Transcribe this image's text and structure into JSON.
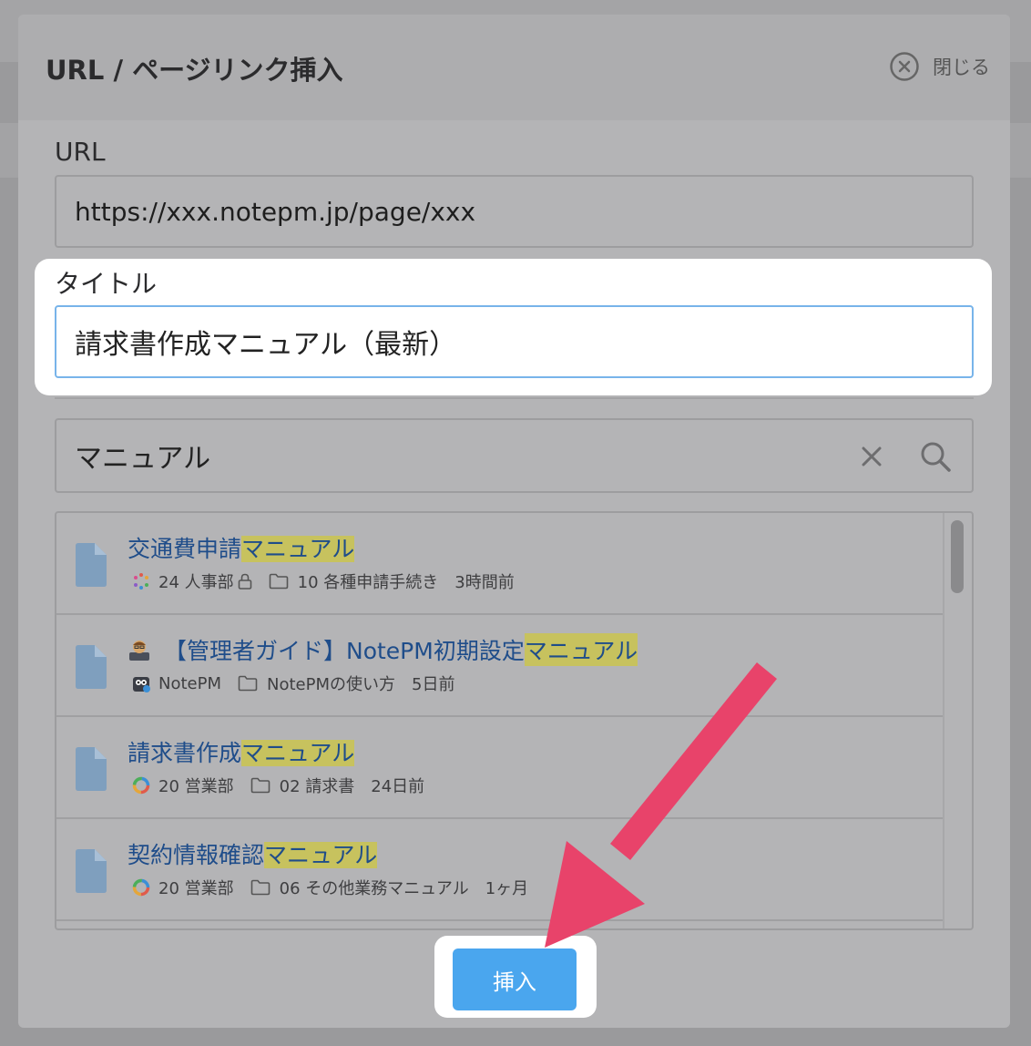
{
  "dialog": {
    "title": "URL / ページリンク挿入",
    "close_label": "閉じる"
  },
  "url_field": {
    "label": "URL",
    "value": "https://xxx.notepm.jp/page/xxx"
  },
  "title_field": {
    "label": "タイトル",
    "value": "請求書作成マニュアル（最新）"
  },
  "search": {
    "value": "マニュアル"
  },
  "results": [
    {
      "title_prefix": "交通費申請",
      "title_highlight": "マニュアル",
      "note": "24 人事部",
      "folder": "10 各種申請手続き",
      "time": "3時間前"
    },
    {
      "title_prefix": "【管理者ガイド】NotePM初期設定",
      "title_highlight": "マニュアル",
      "note": "NotePM",
      "folder": "NotePMの使い方",
      "time": "5日前"
    },
    {
      "title_prefix": "請求書作成",
      "title_highlight": "マニュアル",
      "note": "20 営業部",
      "folder": "02 請求書",
      "time": "24日前"
    },
    {
      "title_prefix": "契約情報確認",
      "title_highlight": "マニュアル",
      "note": "20 営業部",
      "folder": "06 その他業務マニュアル",
      "time": "1ヶ月"
    }
  ],
  "insert_button": "挿入",
  "colors": {
    "accent": "#4aa6ee",
    "highlight": "#c7c25e",
    "link": "#1f4d8a",
    "arrow": "#e8436a"
  }
}
